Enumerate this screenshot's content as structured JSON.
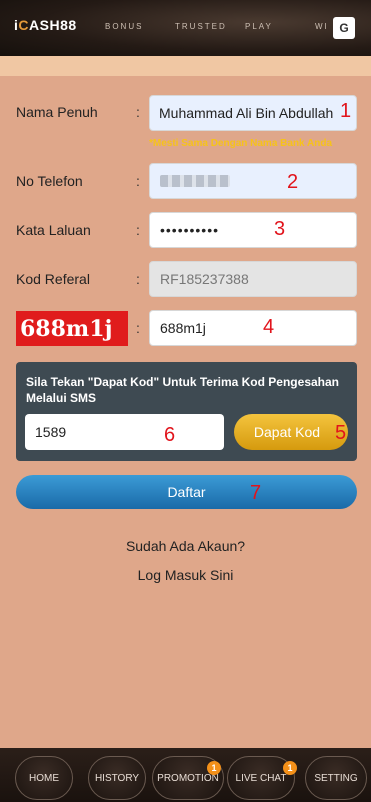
{
  "header": {
    "logo_prefix": "i",
    "logo_main": "ASH88",
    "nav": [
      "BONUS",
      "TRUSTED",
      "PLAY",
      "WI"
    ],
    "lang_icon": "G"
  },
  "form": {
    "name_label": "Nama Penuh",
    "name_value": "Muhammad Ali Bin Abdullah",
    "name_hint": "*Mesti Sama Dengan Nama Bank Anda",
    "phone_label": "No Telefon",
    "password_label": "Kata Laluan",
    "password_value": "••••••••••",
    "referral_label": "Kod Referal",
    "referral_value": "RF185237388",
    "captcha_image_text": "688m1j",
    "captcha_value": "688m1j",
    "colon": ":"
  },
  "sms": {
    "instruction": "Sila Tekan \"Dapat Kod\" Untuk Terima Kod Pengesahan Melalui SMS",
    "code_value": "1589",
    "get_code_label": "Dapat Kod"
  },
  "register_label": "Daftar",
  "login_prompt": "Sudah Ada Akaun?",
  "login_link": "Log Masuk Sini",
  "annotations": [
    "1",
    "2",
    "3",
    "4",
    "5",
    "6",
    "7",
    "6"
  ],
  "bottom_nav": {
    "home": "HOME",
    "history": "HISTORY",
    "promotion": "PROMOTION",
    "promotion_badge": "1",
    "live_chat": "LIVE CHAT",
    "live_chat_badge": "1",
    "setting": "SETTING"
  }
}
